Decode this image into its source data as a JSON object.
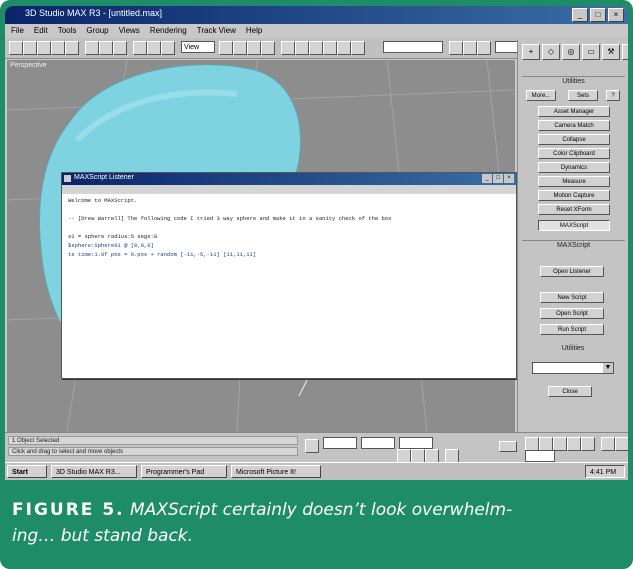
{
  "app": {
    "title": "3D Studio MAX R3 - [untitled.max]",
    "menu": [
      "File",
      "Edit",
      "Tools",
      "Group",
      "Views",
      "Rendering",
      "Track View",
      "Help"
    ]
  },
  "toolbar": {
    "field_value": "View"
  },
  "viewport": {
    "label": "Perspective"
  },
  "listener": {
    "title": "MAXScript Listener",
    "lines": [
      "Welcome to MAXScript.",
      "",
      "-- [Drew Warrell] The following code I tried 3 way sphere and make it in a sanity check of the box",
      "",
      "s1 = sphere radius:5 segs:8",
      "$sphere:Sphere01 @ [0,0,0]",
      "   ts time:1.0f pos = 0.pos + random [-11,-5,-11] [11,11,11]"
    ]
  },
  "command_panel": {
    "tabs": [
      "+",
      "◇",
      "◎",
      "▭",
      "⚒",
      "T"
    ],
    "utilities_header": "Utilities",
    "top_buttons": [
      "More...",
      "Sets",
      "?"
    ],
    "buttons": [
      "Asset Manager",
      "Camera Match",
      "Collapse",
      "Color Clipboard",
      "Dynamics",
      "Measure",
      "Motion Capture",
      "Reset XForm",
      "MAXScript"
    ],
    "maxscript_header": "MAXScript",
    "script_buttons": [
      "Open Listener",
      "New Script",
      "Open Script",
      "Run Script"
    ],
    "utilities_label": "Utilities",
    "close_button": "Close"
  },
  "status": {
    "line1": "1 Object Selected",
    "line2": "Click and drag to select and move objects"
  },
  "taskbar": {
    "start": "Start",
    "tasks": [
      "3D Studio MAX R3...",
      "Programmer's Pad",
      "Microsoft Picture It!"
    ],
    "tray": "4:41 PM"
  },
  "caption": {
    "label": "FIGURE 5.",
    "text_line1": "MAXScript certainly doesn’t look overwhelm-",
    "text_line2": "ing… but stand back."
  },
  "colors": {
    "frame": "#1e8c66",
    "sphere": "#7fd2df",
    "viewport_bg": "#8d8d8d"
  }
}
